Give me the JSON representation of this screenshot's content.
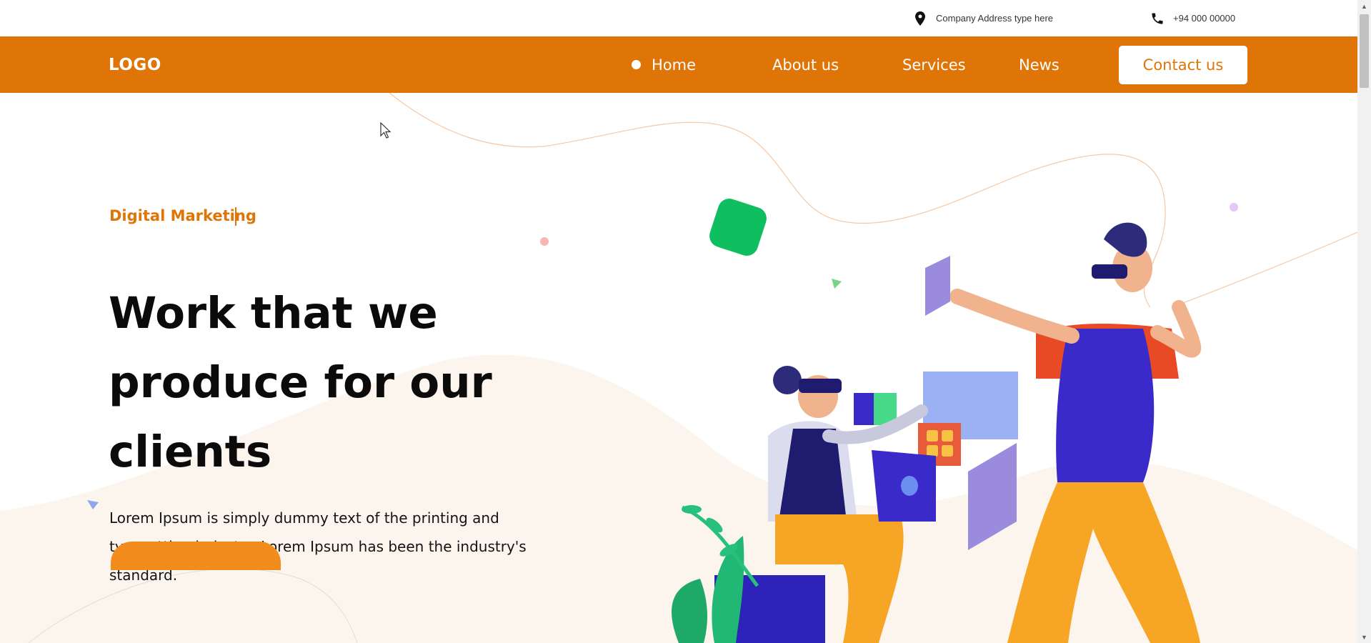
{
  "topbar": {
    "address": {
      "icon": "location-pin-icon",
      "text": "Company Address type here"
    },
    "phone": {
      "icon": "phone-icon",
      "text": "+94 000 00000"
    }
  },
  "nav": {
    "logo": "LOGO",
    "items": [
      {
        "label": "Home",
        "active": true
      },
      {
        "label": "About us"
      },
      {
        "label": "Services"
      },
      {
        "label": "News"
      }
    ],
    "contact_label": "Contact us"
  },
  "hero": {
    "eyebrow": "Digital Marketing",
    "headline": [
      "Work that we",
      "produce for our",
      "clients"
    ],
    "lead": "Lorem Ipsum is simply dummy text of the printing and typesetting industry. Lorem Ipsum has been the industry's standard."
  },
  "colors": {
    "brand": "#e07507",
    "cta": "#f28c1c",
    "hero_blob": "#fcf5ee",
    "text": "#0b0b0b"
  }
}
